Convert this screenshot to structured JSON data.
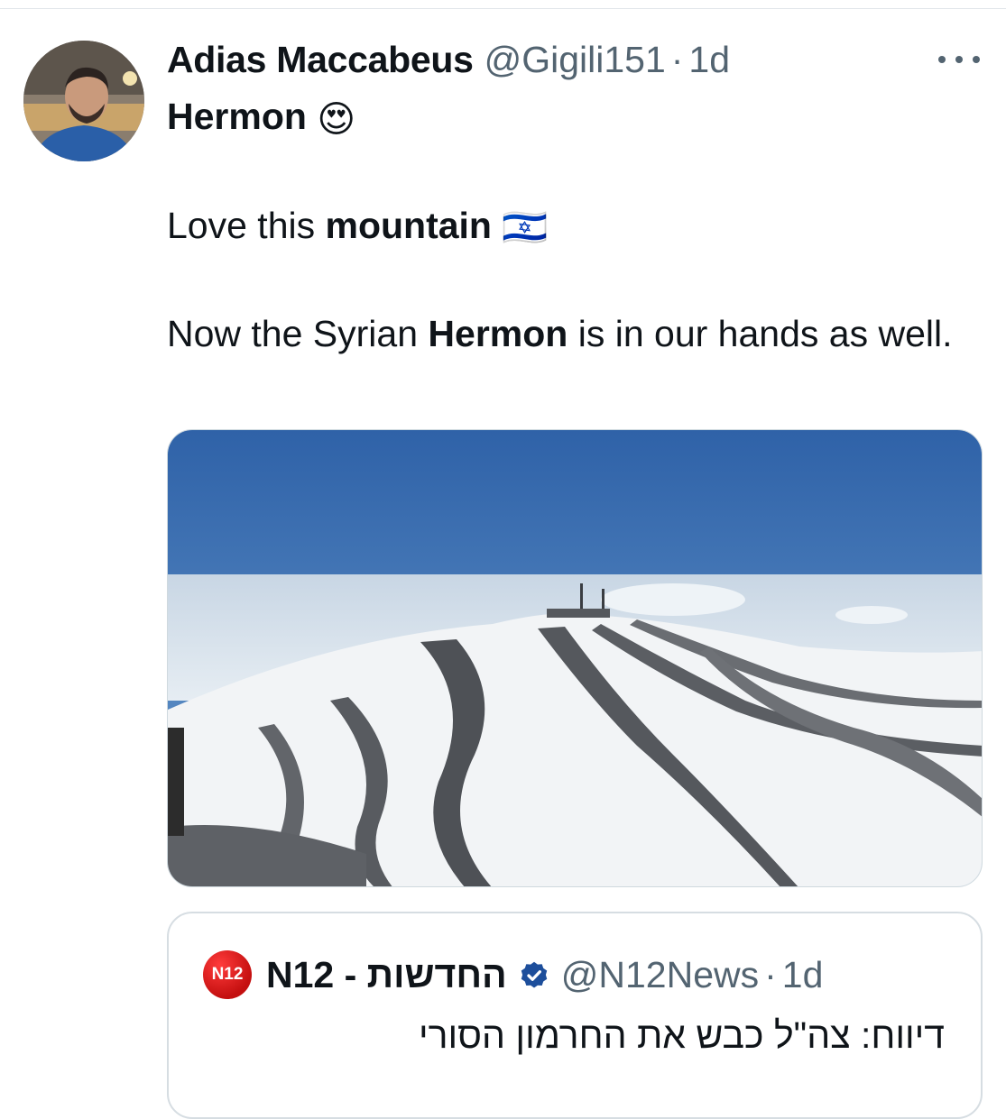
{
  "tweet": {
    "display_name": "Adias Maccabeus",
    "handle": "@Gigili151",
    "separator": "·",
    "time": "1d",
    "more_icon": "more-horizontal-icon",
    "line1_bold": "Hermon",
    "line1_emoji": "😍",
    "line2_text": "Love this ",
    "line2_bold": "mountain",
    "line2_emoji": "🇮🇱",
    "line3_text_a": "Now the Syrian ",
    "line3_bold": "Hermon",
    "line3_text_b": " is in our hands as well."
  },
  "quote": {
    "avatar_text": "N12",
    "name": "N12 - החדשות",
    "verified_icon": "verified-badge-icon",
    "handle": "@N12News",
    "separator": "·",
    "time": "1d",
    "text": "דיווח: צה\"ל כבש את החרמון הסורי"
  },
  "colors": {
    "text": "#0f1419",
    "secondary": "#536471",
    "verified": "#1d4e9b",
    "n12_red": "#d71414"
  }
}
